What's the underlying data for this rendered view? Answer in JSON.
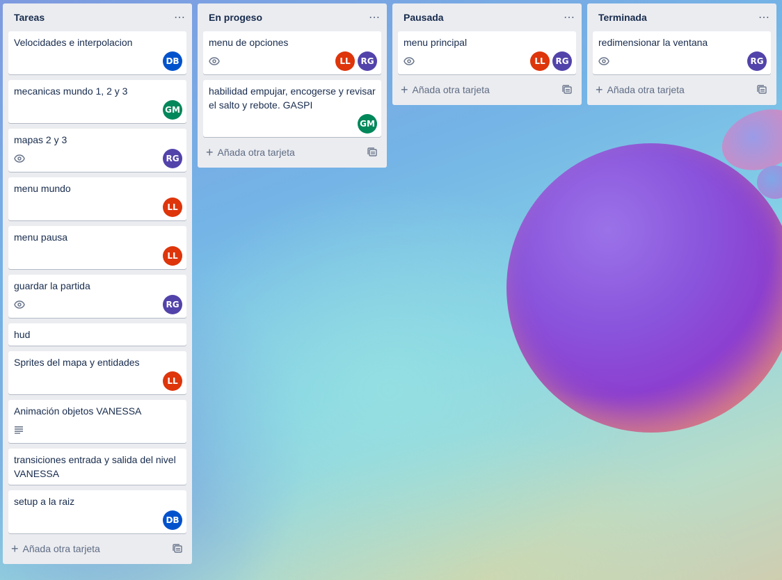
{
  "colors": {
    "DB": "#0052cc",
    "GM": "#00875a",
    "RG": "#5243aa",
    "LL": "#de350b"
  },
  "lists": [
    {
      "title": "Tareas",
      "menu_icon": "ellipsis-icon",
      "add_label": "Añada otra tarjeta",
      "cards": [
        {
          "title": "Velocidades e interpolacion",
          "badges": [],
          "members": [
            "DB"
          ]
        },
        {
          "title": "mecanicas mundo 1, 2 y 3",
          "badges": [],
          "members": [
            "GM"
          ]
        },
        {
          "title": "mapas 2 y 3",
          "badges": [
            "eye-icon"
          ],
          "members": [
            "RG"
          ]
        },
        {
          "title": "menu mundo",
          "badges": [],
          "members": [
            "LL"
          ]
        },
        {
          "title": "menu pausa",
          "badges": [],
          "members": [
            "LL"
          ]
        },
        {
          "title": "guardar la partida",
          "badges": [
            "eye-icon"
          ],
          "members": [
            "RG"
          ]
        },
        {
          "title": "hud",
          "badges": [],
          "members": []
        },
        {
          "title": "Sprites del mapa y entidades",
          "badges": [],
          "members": [
            "LL"
          ]
        },
        {
          "title": "Animación objetos VANESSA",
          "badges": [
            "description-icon"
          ],
          "members": []
        },
        {
          "title": "transiciones entrada y salida del nivel VANESSA",
          "badges": [],
          "members": []
        },
        {
          "title": "setup a la raiz",
          "badges": [],
          "members": [
            "DB"
          ]
        }
      ]
    },
    {
      "title": "En progeso",
      "menu_icon": "ellipsis-icon",
      "add_label": "Añada otra tarjeta",
      "cards": [
        {
          "title": "menu de opciones",
          "badges": [
            "eye-icon"
          ],
          "members": [
            "LL",
            "RG"
          ]
        },
        {
          "title": "habilidad empujar, encogerse y revisar el salto y rebote. GASPI",
          "badges": [],
          "members": [
            "GM"
          ]
        }
      ]
    },
    {
      "title": "Pausada",
      "menu_icon": "ellipsis-icon",
      "add_label": "Añada otra tarjeta",
      "cards": [
        {
          "title": "menu principal",
          "badges": [
            "eye-icon"
          ],
          "members": [
            "LL",
            "RG"
          ]
        }
      ]
    },
    {
      "title": "Terminada",
      "menu_icon": "ellipsis-icon",
      "add_label": "Añada otra tarjeta",
      "cards": [
        {
          "title": "redimensionar la ventana",
          "badges": [
            "eye-icon"
          ],
          "members": [
            "RG"
          ]
        }
      ]
    }
  ]
}
